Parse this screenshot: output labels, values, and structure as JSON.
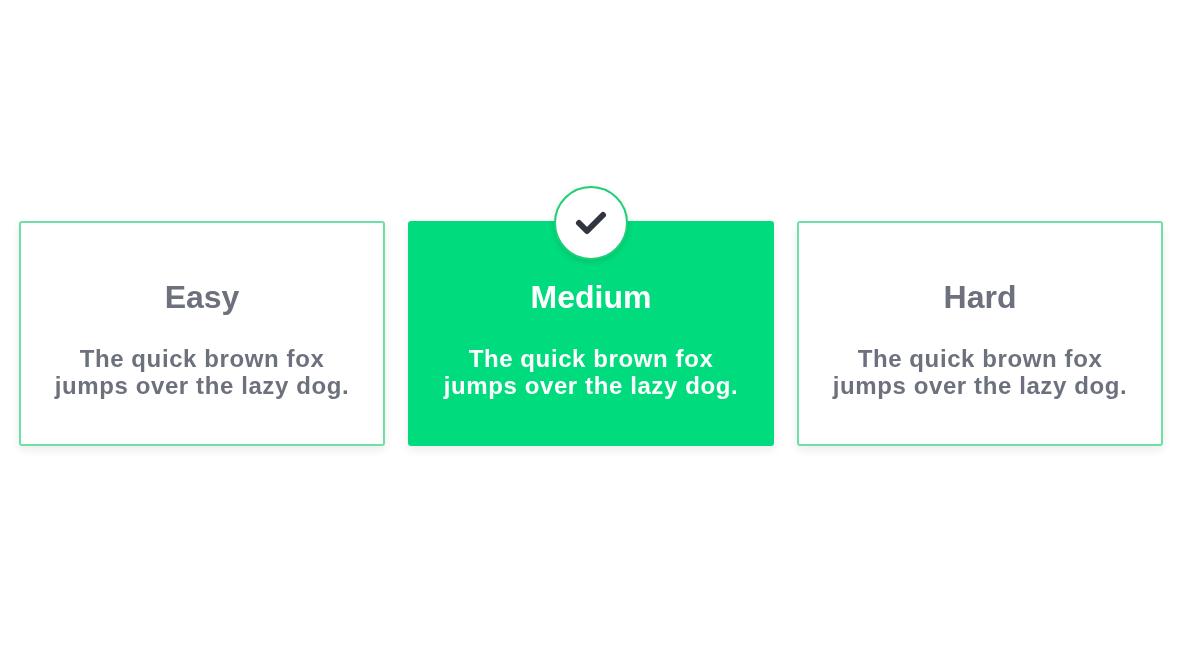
{
  "options": [
    {
      "title": "Easy",
      "description": "The quick brown fox jumps over the lazy dog.",
      "selected": false
    },
    {
      "title": "Medium",
      "description": "The quick brown fox jumps over the lazy dog.",
      "selected": true
    },
    {
      "title": "Hard",
      "description": "The quick brown fox jumps over the lazy dog.",
      "selected": false
    }
  ]
}
